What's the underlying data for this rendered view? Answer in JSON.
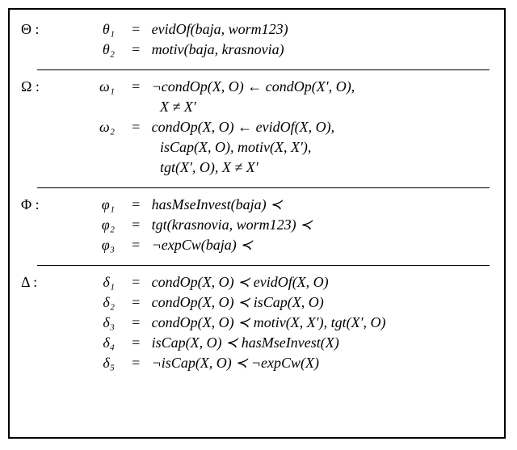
{
  "theta": {
    "set": "Θ :",
    "items": [
      {
        "label": "θ₁",
        "eq": "=",
        "body": "evidOf(baja, worm123)"
      },
      {
        "label": "θ₂",
        "eq": "=",
        "body": "motiv(baja, krasnovia)"
      }
    ]
  },
  "omega": {
    "set": "Ω :",
    "items": [
      {
        "label": "ω₁",
        "eq": "=",
        "body": "¬condOp(X, O) ← condOp(X′, O),",
        "cont": [
          "X ≠ X′"
        ]
      },
      {
        "label": "ω₂",
        "eq": "=",
        "body": "condOp(X, O) ← evidOf(X, O),",
        "cont": [
          "isCap(X, O), motiv(X, X′),",
          "tgt(X′, O), X ≠ X′"
        ]
      }
    ]
  },
  "phi": {
    "set": "Φ :",
    "items": [
      {
        "label": "φ₁",
        "eq": "=",
        "body": "hasMseInvest(baja) ≺"
      },
      {
        "label": "φ₂",
        "eq": "=",
        "body": "tgt(krasnovia, worm123) ≺"
      },
      {
        "label": "φ₃",
        "eq": "=",
        "body": "¬expCw(baja) ≺"
      }
    ]
  },
  "delta": {
    "set": "Δ :",
    "items": [
      {
        "label": "δ₁",
        "eq": "=",
        "body": "condOp(X, O) ≺ evidOf(X, O)"
      },
      {
        "label": "δ₂",
        "eq": "=",
        "body": "condOp(X, O) ≺ isCap(X, O)"
      },
      {
        "label": "δ₃",
        "eq": "=",
        "body": "condOp(X, O) ≺ motiv(X, X′), tgt(X′, O)"
      },
      {
        "label": "δ₄",
        "eq": "=",
        "body": "isCap(X, O) ≺ hasMseInvest(X)"
      },
      {
        "label": "δ₅",
        "eq": "=",
        "body": "¬isCap(X, O) ≺ ¬expCw(X)"
      }
    ]
  }
}
